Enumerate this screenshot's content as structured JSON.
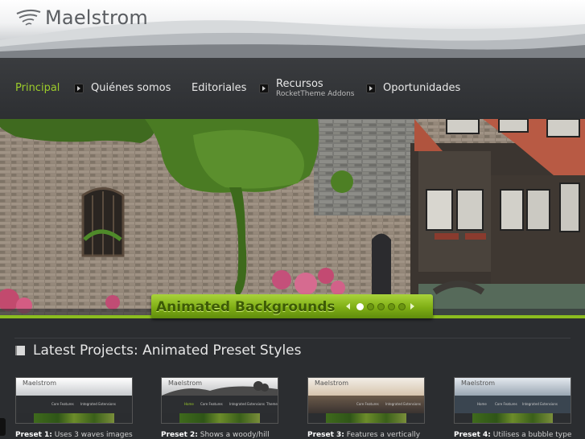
{
  "brand": {
    "name": "Maelstrom"
  },
  "nav": {
    "items": [
      {
        "label": "Principal",
        "active": true
      },
      {
        "label": "Quiénes somos"
      },
      {
        "label": "Editoriales"
      },
      {
        "label": "Recursos",
        "sublabel": "RocketTheme Addons"
      },
      {
        "label": "Oportunidades"
      }
    ]
  },
  "hero": {
    "title": "Animated Backgrounds",
    "slides": 5,
    "active_slide": 1
  },
  "section": {
    "title": "Latest Projects: Animated Preset Styles"
  },
  "projects": [
    {
      "thumb_logo": "Maelstrom",
      "caption_bold": "Preset 1:",
      "caption": " Uses 3 waves images"
    },
    {
      "thumb_logo": "Maelstrom",
      "caption_bold": "Preset 2:",
      "caption": " Shows a woody/hill"
    },
    {
      "thumb_logo": "Maelstrom",
      "caption_bold": "Preset 3:",
      "caption": " Features a vertically"
    },
    {
      "thumb_logo": "Maelstrom",
      "caption_bold": "Preset 4:",
      "caption": " Utilises a bubble type"
    }
  ],
  "thumb_nav": {
    "home": "Home",
    "core": "Core Features",
    "integrated": "Integrated Extensions",
    "theme": "Theme"
  },
  "colors": {
    "accent": "#9ccc2a",
    "hero_bar": "#7fae15",
    "background": "#2b2d30"
  }
}
